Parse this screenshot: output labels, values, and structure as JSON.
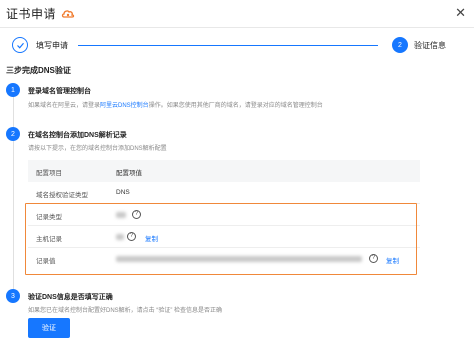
{
  "window": {
    "title": "证书申请",
    "close_icon": "close-icon"
  },
  "steps": [
    {
      "label": "填写申请",
      "state": "done"
    },
    {
      "number": "2",
      "label": "验证信息",
      "state": "active"
    }
  ],
  "section_title": "三步完成DNS验证",
  "items": [
    {
      "number": "1",
      "title": "登录域名管理控制台",
      "desc_before": "如果域名在阿里云，请登录",
      "desc_link": "阿里云DNS控制台",
      "desc_after": "操作。如果您使用其他厂商的域名，请登录对应的域名管理控制台"
    },
    {
      "number": "2",
      "title": "在域名控制台添加DNS解析记录",
      "desc": "请按以下提示，在您的域名控制台添加DNS解析配置"
    },
    {
      "number": "3",
      "title": "验证DNS信息是否填写正确",
      "desc": "如果您已在域名控制台配置好DNS解析，请点击 “验证” 检查信息是否正确"
    }
  ],
  "table": {
    "header": {
      "key": "配置项目",
      "value": "配置项值"
    },
    "rows": [
      {
        "key": "域名授权验证类型",
        "value": "DNS"
      },
      {
        "key": "记录类型",
        "value": ""
      },
      {
        "key": "主机记录",
        "value": "",
        "copy": "复制"
      },
      {
        "key": "记录值",
        "value": "",
        "copy": "复制"
      }
    ]
  },
  "verify_button": "验证",
  "colors": {
    "accent": "#1677ff",
    "highlight": "#f0883a"
  }
}
